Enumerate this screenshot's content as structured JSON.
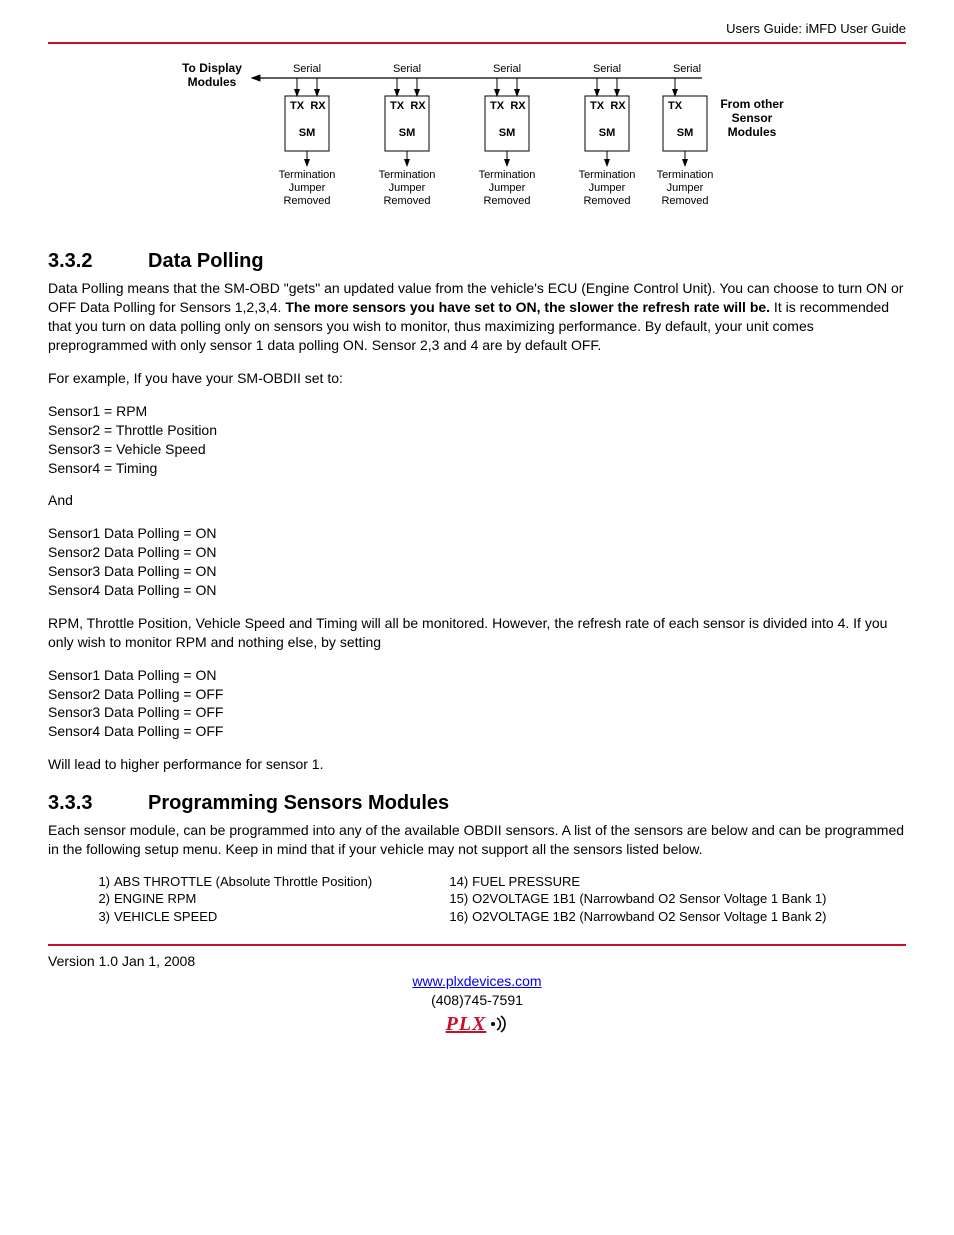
{
  "header": {
    "guide": "Users Guide: iMFD User Guide"
  },
  "diagram": {
    "toDisplay1": "To Display",
    "toDisplay2": "Modules",
    "serial": "Serial",
    "tx": "TX",
    "rx": "RX",
    "sm": "SM",
    "termination1": "Termination",
    "termination2": "Jumper",
    "termination3": "Removed",
    "fromOther1": "From other",
    "fromOther2": "Sensor",
    "fromOther3": "Modules"
  },
  "section332": {
    "num": "3.3.2",
    "title": "Data Polling",
    "p1a": "Data Polling means that the SM-OBD \"gets\" an updated value from the vehicle's ECU (Engine Control Unit). You can choose to turn ON or OFF Data Polling for Sensors 1,2,3,4. ",
    "p1b": "The more sensors you have set to ON, the slower the refresh rate will be.",
    "p1c": " It is recommended that you turn on data polling only on sensors you wish to monitor, thus maximizing performance. By default, your unit comes preprogrammed with only sensor 1 data polling ON. Sensor 2,3 and 4 are by default OFF.",
    "p2": "For example, If you have your SM-OBDII set to:",
    "sensorsA": [
      "Sensor1 = RPM",
      "Sensor2 = Throttle Position",
      "Sensor3 = Vehicle Speed",
      "Sensor4 = Timing"
    ],
    "and": "And",
    "sensorsB": [
      "Sensor1 Data Polling = ON",
      "Sensor2 Data Polling = ON",
      "Sensor3 Data Polling = ON",
      "Sensor4 Data Polling = ON"
    ],
    "p3": "RPM, Throttle Position, Vehicle Speed and Timing will all be monitored. However, the refresh rate of each sensor is divided into 4. If you only wish to monitor RPM and nothing else, by setting",
    "sensorsC": [
      "Sensor1 Data Polling = ON",
      "Sensor2 Data Polling = OFF",
      "Sensor3 Data Polling = OFF",
      "Sensor4 Data Polling = OFF"
    ],
    "p4": "Will lead to higher performance for sensor 1."
  },
  "section333": {
    "num": "3.3.3",
    "title": "Programming Sensors Modules",
    "p1": "Each sensor module, can be programmed into any of the available OBDII sensors. A list of the sensors are below and can be programmed in the following setup menu. Keep in mind that if your vehicle may not support all the sensors listed below.",
    "colA": [
      {
        "n": "1)",
        "t": "ABS THROTTLE (Absolute Throttle Position)"
      },
      {
        "n": "2)",
        "t": "ENGINE RPM"
      },
      {
        "n": "3)",
        "t": "VEHICLE SPEED"
      }
    ],
    "colB": [
      {
        "n": "14)",
        "t": "FUEL PRESSURE"
      },
      {
        "n": "15)",
        "t": "O2VOLTAGE 1B1 (Narrowband O2 Sensor Voltage 1 Bank 1)"
      },
      {
        "n": "16)",
        "t": "O2VOLTAGE 1B2 (Narrowband O2 Sensor Voltage 1 Bank 2)"
      }
    ]
  },
  "footer": {
    "version": "Version 1.0 Jan 1, 2008",
    "url": "www.plxdevices.com",
    "phone": "(408)745-7591",
    "logo": "PLX"
  }
}
